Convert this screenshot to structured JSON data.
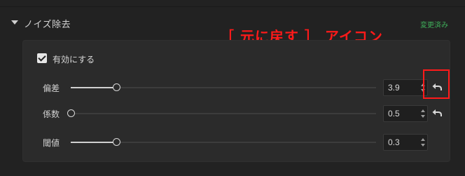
{
  "section": {
    "title": "ノイズ除去",
    "changed_badge": "変更済み"
  },
  "annotation": {
    "text": "［ 元に戻す ］ アイコン",
    "color": "#ff1a1a"
  },
  "enable": {
    "label": "有効にする",
    "checked": true
  },
  "params": [
    {
      "label": "偏差",
      "value": "3.9",
      "level": 0.15,
      "reset_highlighted": true
    },
    {
      "label": "係数",
      "value": "0.5",
      "level": 0.0,
      "reset_highlighted": false
    },
    {
      "label": "閾値",
      "value": "0.3",
      "level": 0.15,
      "reset_highlighted": false
    }
  ],
  "icons": {
    "collapse": "triangle-down-icon",
    "reset": "undo-arrow-icon",
    "checkbox": "checkmark-icon"
  },
  "colors": {
    "accent_green": "#3fae5a",
    "annotation_red": "#ff1a1a",
    "background": "#222222",
    "panel": "#2b2b2b"
  }
}
